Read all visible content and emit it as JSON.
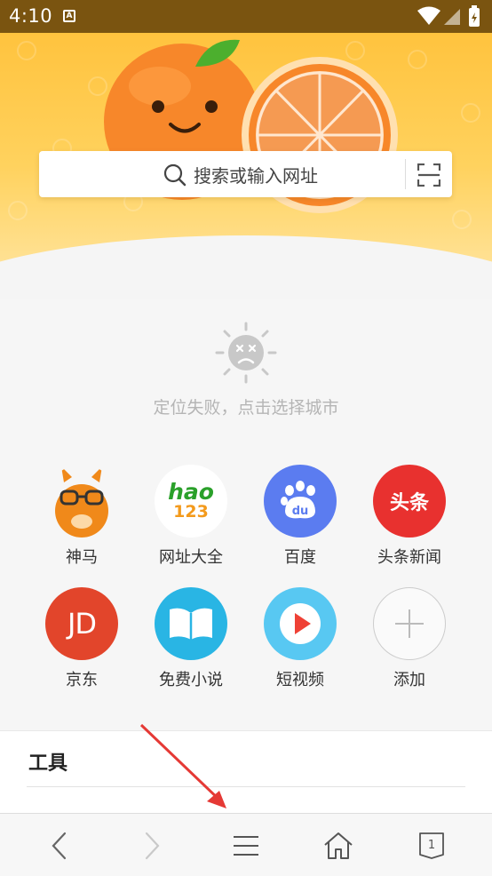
{
  "status_bar": {
    "time": "4:10",
    "notification_icon": "A"
  },
  "search": {
    "placeholder": "搜索或输入网址",
    "icons": [
      "search-icon",
      "scan-icon"
    ]
  },
  "location": {
    "message": "定位失败，点击选择城市",
    "icon": "sad-sun-icon"
  },
  "shortcuts": [
    {
      "label": "神马",
      "icon": "llama-icon",
      "color": "#f0891a"
    },
    {
      "label": "网址大全",
      "icon": "hao123-icon",
      "text": "hao",
      "sub": "123",
      "color": "#ffffff"
    },
    {
      "label": "百度",
      "icon": "paw-icon",
      "text": "du",
      "color": "#5b7cf0"
    },
    {
      "label": "头条新闻",
      "icon": "toutiao-icon",
      "text": "头条",
      "color": "#e8312f"
    },
    {
      "label": "京东",
      "icon": "jd-icon",
      "text": "JD",
      "color": "#e2452b"
    },
    {
      "label": "免费小说",
      "icon": "book-icon",
      "color": "#29b5e4"
    },
    {
      "label": "短视频",
      "icon": "play-icon",
      "color": "#58c8f2"
    },
    {
      "label": "添加",
      "icon": "plus-icon",
      "color": "#ffffff"
    }
  ],
  "tools": {
    "title": "工具"
  },
  "bottom_nav": {
    "items": [
      "back-icon",
      "forward-icon",
      "menu-icon",
      "home-icon",
      "tabs-icon"
    ],
    "tab_count": "1"
  },
  "colors": {
    "status_bar": "#7a5410",
    "hero": "#ffc33e",
    "annotation_arrow": "#e53935"
  }
}
